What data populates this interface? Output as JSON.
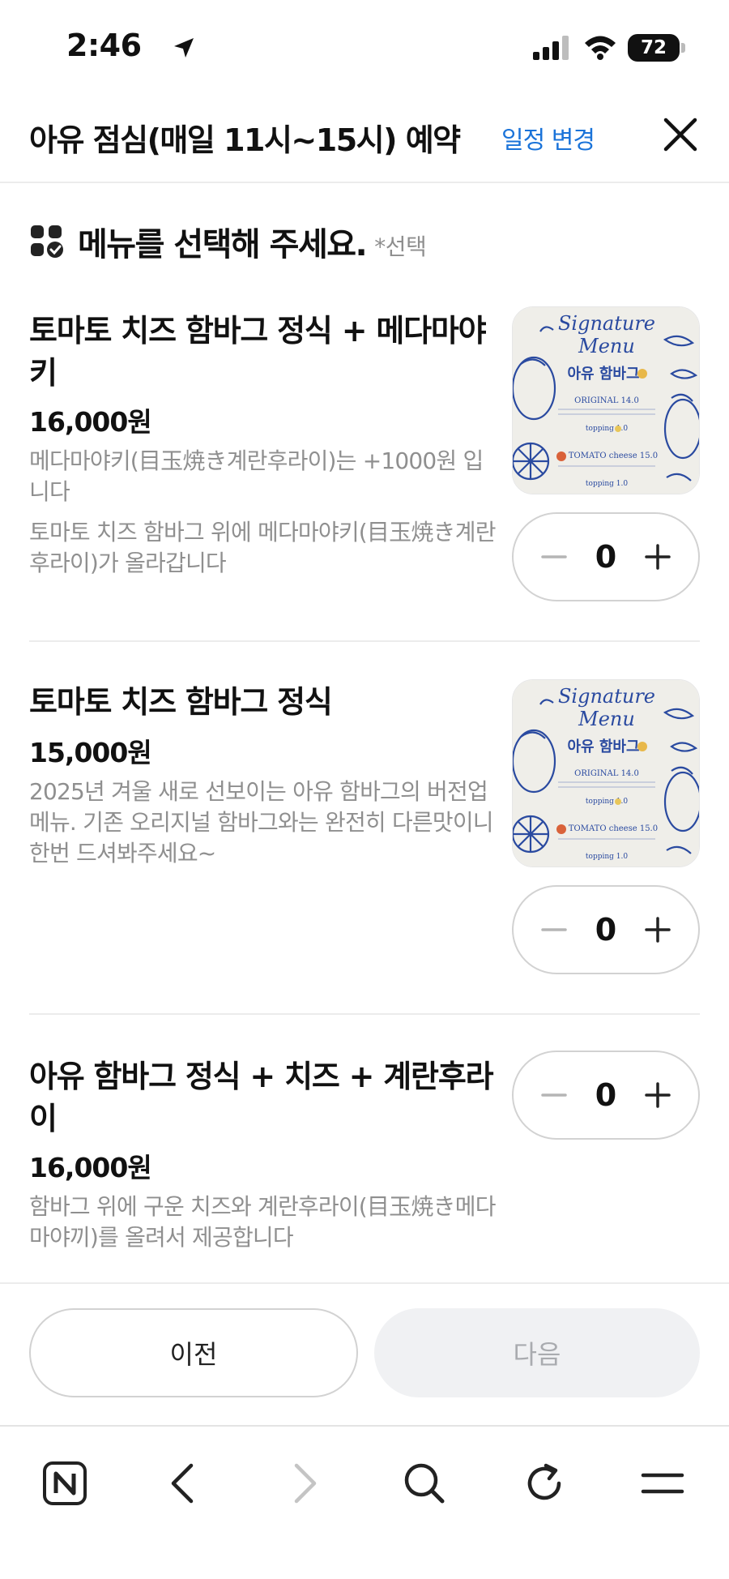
{
  "status_bar": {
    "time": "2:46",
    "battery": "72"
  },
  "header": {
    "title": "아유 점심(매일 11시~15시) 예약",
    "schedule_link": "일정 변경"
  },
  "section": {
    "title": "메뉴를 선택해 주세요.",
    "note": "*선택"
  },
  "menu": [
    {
      "name": "토마토 치즈 함바그 정식 + 메다마야키",
      "price": "16,000원",
      "desc1": "메다마야키(目玉焼き계란후라이)는 +1000원 입니다",
      "desc2": "토마토 치즈 함바그 위에 메다마야키(目玉焼き계란후라이)가 올라갑니다",
      "qty": "0"
    },
    {
      "name": "토마토 치즈 함바그 정식",
      "price": "15,000원",
      "desc1": "2025년 겨울 새로 선보이는 아유 함바그의 버전업 메뉴. 기존 오리지널 함바그와는 완전히 다른맛이니 한번 드셔봐주세요~",
      "qty": "0"
    },
    {
      "name": "아유 함바그 정식 + 치즈 + 계란후라이",
      "price": "16,000원",
      "desc1": "함바그 위에 구운 치즈와 계란후라이(目玉焼き메다마야끼)를 올려서 제공합니다",
      "qty": "0"
    }
  ],
  "thumbnail": {
    "line1": "Signature",
    "line2": "Menu",
    "heading": "아유 함바그",
    "row1": "ORIGINAL   14.0",
    "row2": "topping   1.0",
    "row3": "TOMATO cheese   15.0",
    "row4": "topping   1.0"
  },
  "actions": {
    "prev_label": "이전",
    "next_label": "다음"
  },
  "colors": {
    "accent_link": "#1a73d9",
    "thumbnail_ink": "#2a4aa0",
    "disabled_bg": "#f0f1f3"
  }
}
